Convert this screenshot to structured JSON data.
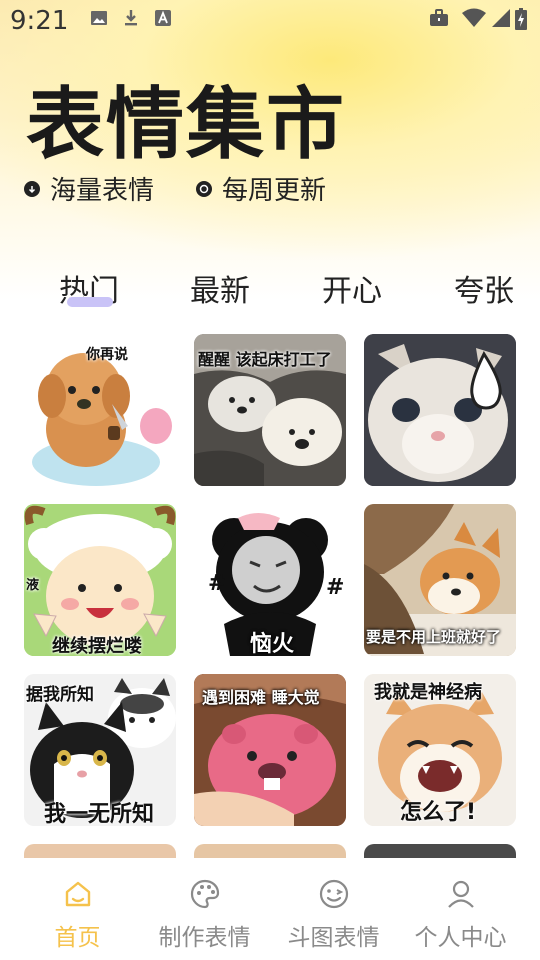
{
  "status_bar": {
    "time": "9:21",
    "left_icons": [
      "gallery-icon",
      "download-icon",
      "font-icon"
    ],
    "right_icons": [
      "briefcase-icon",
      "wifi-icon",
      "signal-icon",
      "battery-icon"
    ]
  },
  "header": {
    "title": "表情集市",
    "features": [
      {
        "icon": "cloud-download-icon",
        "label": "海量表情"
      },
      {
        "icon": "refresh-icon",
        "label": "每周更新"
      }
    ]
  },
  "tabs": [
    {
      "label": "热门",
      "active": true
    },
    {
      "label": "最新",
      "active": false
    },
    {
      "label": "开心",
      "active": false
    },
    {
      "label": "夸张",
      "active": false
    }
  ],
  "stickers": [
    {
      "name": "sticker-puppy-knife",
      "caption": "你再说"
    },
    {
      "name": "sticker-bears-bed",
      "caption": "醒醒 该起床打工了"
    },
    {
      "name": "sticker-cat-sweat",
      "caption": ""
    },
    {
      "name": "sticker-sheep-v",
      "caption": "继续摆烂喽",
      "side_text": "液"
    },
    {
      "name": "sticker-panda-face",
      "caption": "恼火"
    },
    {
      "name": "sticker-shiba-blanket",
      "caption": "要是不用上班就好了"
    },
    {
      "name": "sticker-cats-knowing",
      "caption_top": "据我所知",
      "caption": "我一无所知"
    },
    {
      "name": "sticker-pink-beaver",
      "caption": "遇到困难  睡大觉"
    },
    {
      "name": "sticker-cat-laughing",
      "caption_top": "我就是神经病",
      "caption": "怎么了!"
    }
  ],
  "bottom_nav": [
    {
      "icon": "home-icon",
      "label": "首页",
      "active": true
    },
    {
      "icon": "palette-icon",
      "label": "制作表情",
      "active": false
    },
    {
      "icon": "wink-face-icon",
      "label": "斗图表情",
      "active": false
    },
    {
      "icon": "person-icon",
      "label": "个人中心",
      "active": false
    }
  ],
  "colors": {
    "accent": "#f5c24c",
    "tab_indicator": "#c9c3f7",
    "inactive": "#8a8a8a"
  }
}
